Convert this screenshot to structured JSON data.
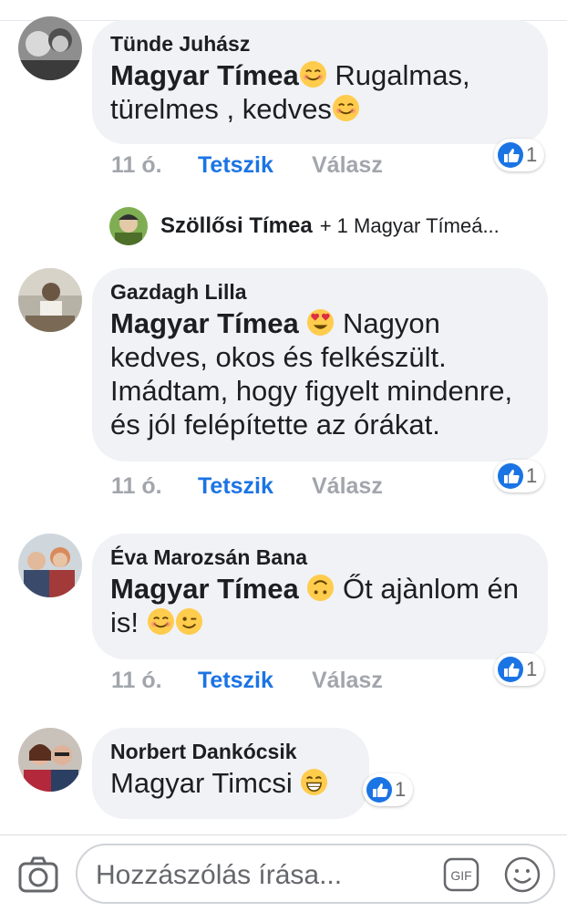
{
  "comments": [
    {
      "author": "Tünde Juhász",
      "mention": "Magyar Tímea",
      "text_line1": " Rugalmas,",
      "text_line2": "türelmes , kedves",
      "time": "11 ó.",
      "like_label": "Tetszik",
      "reply_label": "Válasz",
      "reaction_count": "1"
    },
    {
      "author": "Gazdagh Lilla",
      "mention": "Magyar Tímea",
      "text_line1": " Nagyon",
      "text_line2": "kedves, okos és felkészült.",
      "text_line3": "Imádtam, hogy figyelt mindenre,",
      "text_line4": "és jól felépítette az órákat.",
      "time": "11 ó.",
      "like_label": "Tetszik",
      "reply_label": "Válasz",
      "reaction_count": "1"
    },
    {
      "author": "Éva Marozsán Bana",
      "mention": "Magyar Tímea",
      "text_line1": " Őt ajànlom én",
      "text_line2": "is! ",
      "time": "11 ó.",
      "like_label": "Tetszik",
      "reply_label": "Válasz",
      "reaction_count": "1"
    },
    {
      "author": "Norbert Dankócsik",
      "text_line1": "Magyar Timcsi ",
      "reaction_count": "1"
    }
  ],
  "reply_thread": {
    "name": "Szöllősi Tímea",
    "rest": "+ 1 Magyar Tímeá..."
  },
  "composer": {
    "placeholder": "Hozzászólás írása...",
    "gif_label": "GIF"
  },
  "colors": {
    "accent_blue": "#1b74e4",
    "bubble_bg": "#f0f2f5",
    "muted_text": "#a2a6ac"
  }
}
